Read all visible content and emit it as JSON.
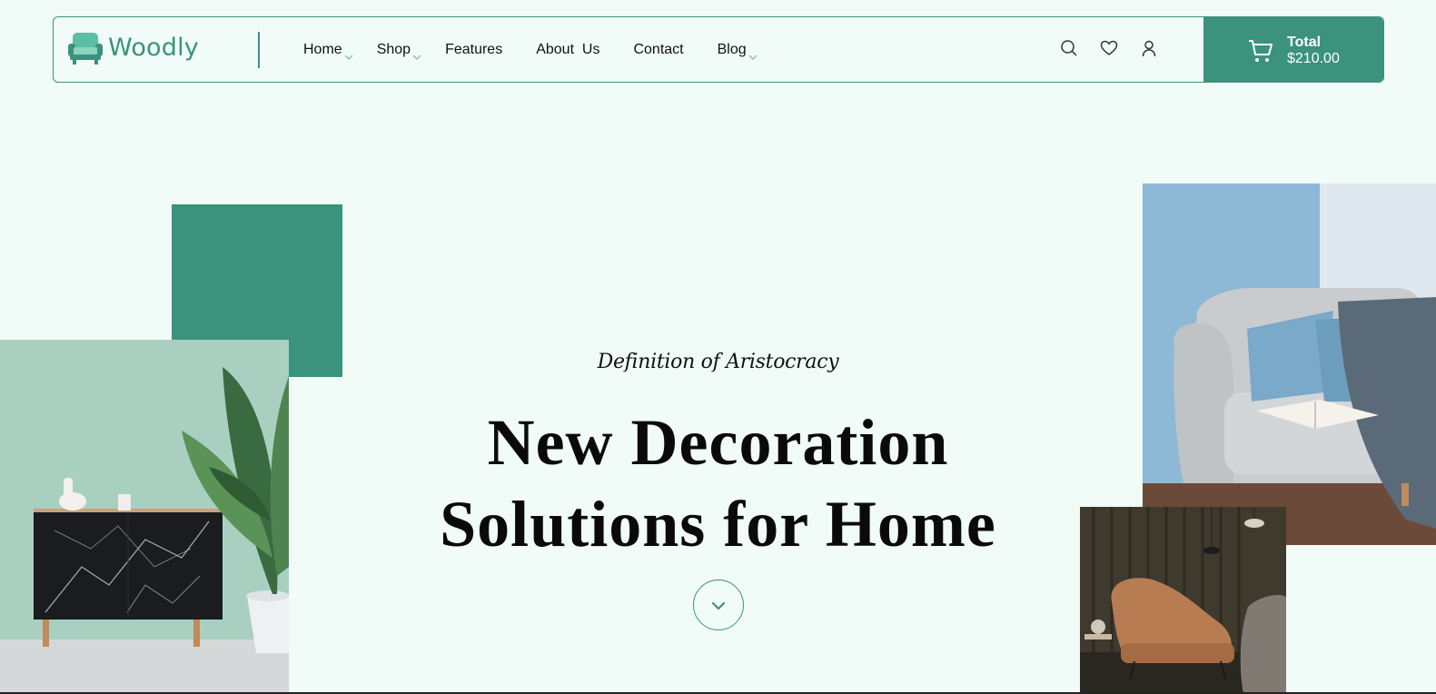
{
  "brand": {
    "name": "Woodly",
    "accent_color": "#3b927d",
    "logo_icon": "armchair-icon"
  },
  "nav": {
    "items": [
      {
        "label": "Home",
        "has_dropdown": true
      },
      {
        "label": "Shop",
        "has_dropdown": true
      },
      {
        "label": "Features",
        "has_dropdown": false
      },
      {
        "label": "About  Us",
        "has_dropdown": false
      },
      {
        "label": "Contact",
        "has_dropdown": false
      },
      {
        "label": "Blog",
        "has_dropdown": true
      }
    ]
  },
  "header_icons": [
    "search-icon",
    "heart-icon",
    "user-icon"
  ],
  "cart": {
    "label": "Total",
    "amount": "$210.00",
    "icon": "cart-icon"
  },
  "hero": {
    "subtitle": "Definition of Aristocracy",
    "title_line_1": "New Decoration",
    "title_line_2": "Solutions for Home",
    "scroll_icon": "chevron-down-icon"
  }
}
